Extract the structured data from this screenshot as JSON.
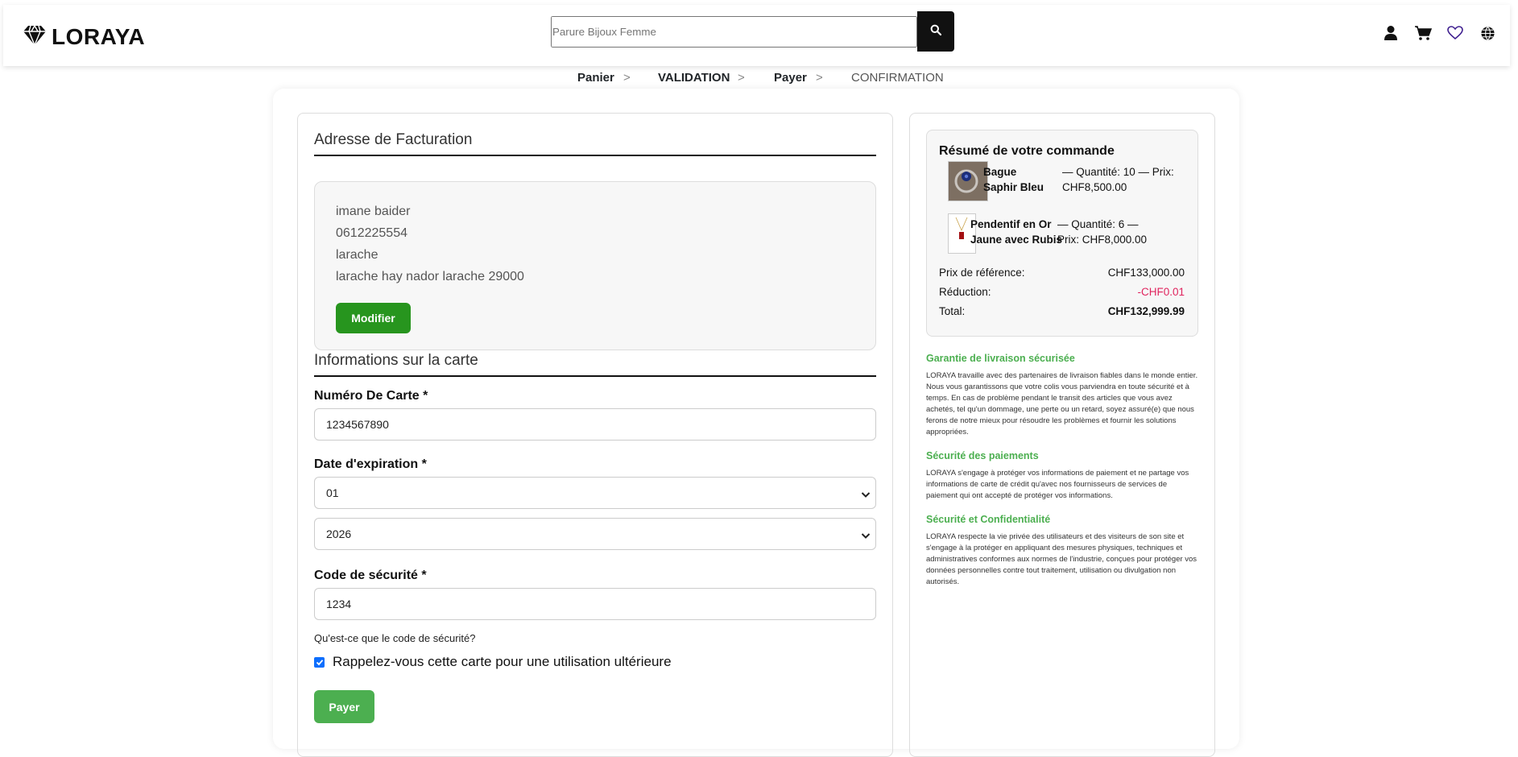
{
  "brand": {
    "name": "LORAYA"
  },
  "search": {
    "placeholder": "Parure Bijoux Femme"
  },
  "header_icons": [
    "user-icon",
    "cart-icon",
    "heart-icon",
    "globe-icon"
  ],
  "steps": [
    {
      "label": "Panier",
      "active": true
    },
    {
      "label": "VALIDATION",
      "active": true
    },
    {
      "label": "Payer",
      "active": true
    },
    {
      "label": "CONFIRMATION",
      "active": false
    }
  ],
  "step_separator": ">",
  "billing": {
    "title": "Adresse de Facturation",
    "name": "imane baider",
    "phone": "0612225554",
    "city": "larache",
    "address": "larache hay nador larache 29000",
    "edit_label": "Modifier"
  },
  "card_info": {
    "title": "Informations sur la carte",
    "number_label": "Numéro De Carte *",
    "number_value": "1234567890",
    "expiry_label": "Date d'expiration *",
    "expiry_month": "01",
    "expiry_year": "2026",
    "cvv_label": "Code de sécurité *",
    "cvv_value": "1234",
    "cvv_hint": "Qu'est-ce que le code de sécurité?",
    "remember_label": "Rappelez-vous cette carte pour une utilisation ultérieure",
    "remember_checked": true,
    "pay_label": "Payer"
  },
  "summary": {
    "title": "Résumé de votre commande",
    "items": [
      {
        "name_line1": "Bague",
        "name_line2": "Saphir Bleu",
        "detail_line1": "— Quantité: 10 — Prix:",
        "detail_line2": "CHF8,500.00"
      },
      {
        "name_line1": "Pendentif en Or",
        "name_line2": "Jaune avec Rubis",
        "detail_line1": "— Quantité: 6 —",
        "detail_line2": "Prix: CHF8,000.00"
      }
    ],
    "reference_label": "Prix de référence:",
    "reference_value": "CHF133,000.00",
    "discount_label": "Réduction:",
    "discount_value": "-CHF0.01",
    "total_label": "Total:",
    "total_value": "CHF132,999.99"
  },
  "info": [
    {
      "title": "Garantie de livraison sécurisée",
      "text": "LORAYA travaille avec des partenaires de livraison fiables dans le monde entier. Nous vous garantissons que votre colis vous parviendra en toute sécurité et à temps. En cas de problème pendant le transit des articles que vous avez achetés, tel qu'un dommage, une perte ou un retard, soyez assuré(e) que nous ferons de notre mieux pour résoudre les problèmes et fournir les solutions appropriées."
    },
    {
      "title": "Sécurité des paiements",
      "text": "LORAYA s'engage à protéger vos informations de paiement et ne partage vos informations de carte de crédit qu'avec nos fournisseurs de services de paiement qui ont accepté de protéger vos informations."
    },
    {
      "title": "Sécurité et Confidentialité",
      "text": "LORAYA respecte la vie privée des utilisateurs et des visiteurs de son site et s'engage à la protéger en appliquant des mesures physiques, techniques et administratives conformes aux normes de l'industrie, conçues pour protéger vos données personnelles contre tout traitement, utilisation ou divulgation non autorisés."
    }
  ],
  "colors": {
    "accent_green": "#4caf50",
    "dark_green": "#27951e",
    "discount_red": "#e0245e",
    "heart_purple": "#3f1f8f"
  }
}
